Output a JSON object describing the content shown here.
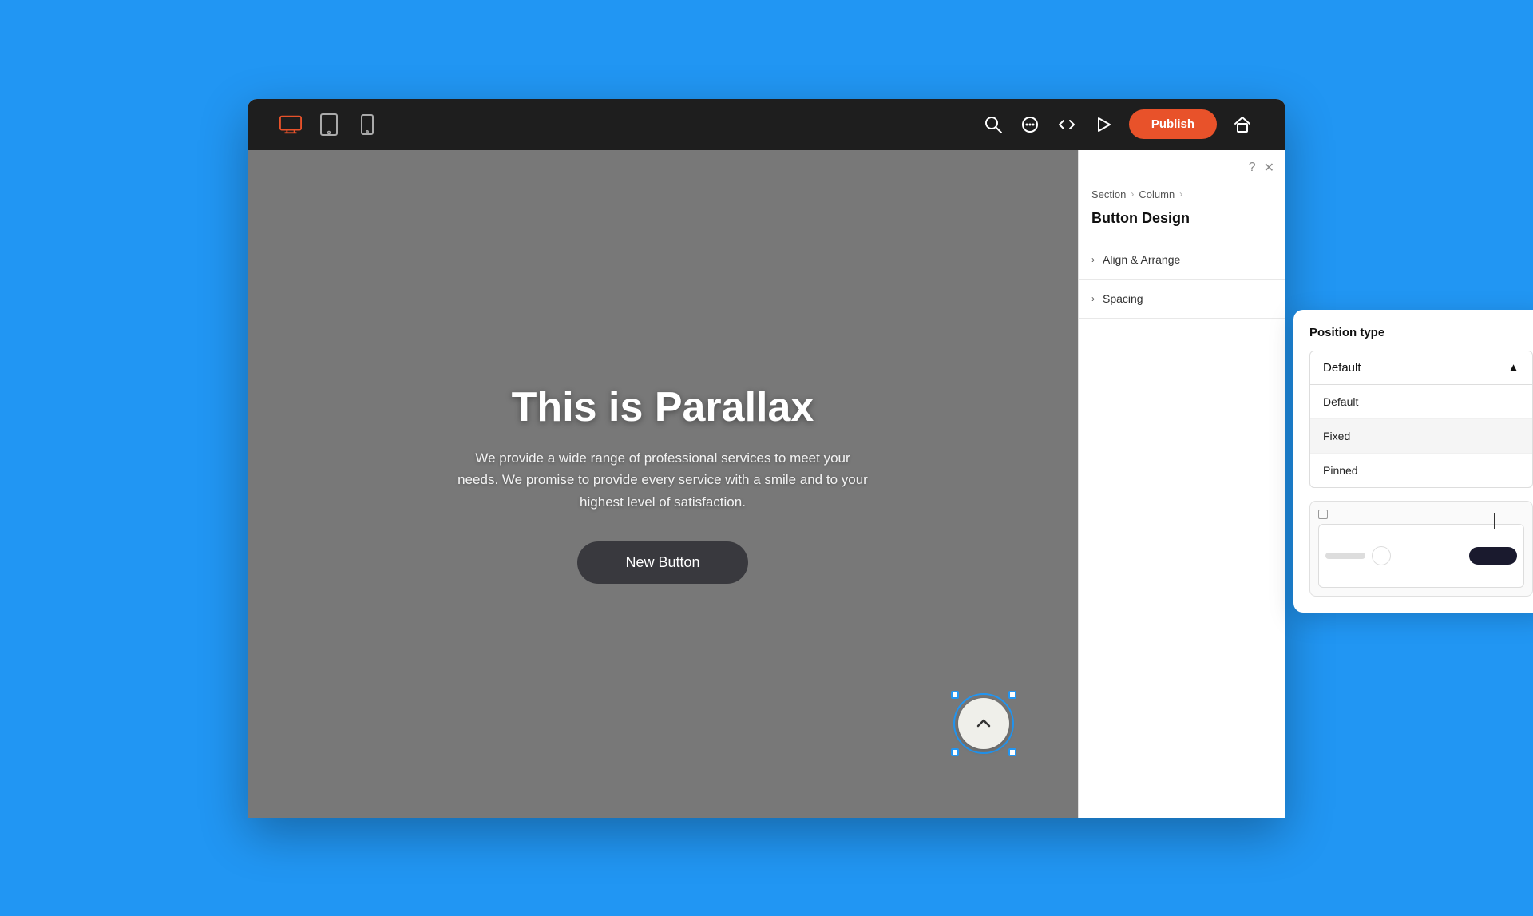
{
  "topbar": {
    "device_icons": [
      {
        "name": "desktop",
        "active": true
      },
      {
        "name": "tablet",
        "active": false
      },
      {
        "name": "mobile",
        "active": false
      }
    ],
    "publish_label": "Publish",
    "tools": [
      "search",
      "chat",
      "code",
      "play",
      "home"
    ]
  },
  "canvas": {
    "title": "This is Parallax",
    "subtitle": "We provide a wide range of professional services to meet your needs. We promise to provide every service with a smile and to your highest level of satisfaction.",
    "button_label": "New Button"
  },
  "panel": {
    "breadcrumb": [
      "Section",
      "Column"
    ],
    "title": "Button Design",
    "sections": [
      {
        "label": "Align & Arrange"
      },
      {
        "label": "Spacing"
      }
    ]
  },
  "floating": {
    "position_type_label": "Position type",
    "selected": "Default",
    "chevron_up": "▲",
    "options": [
      "Default",
      "Fixed",
      "Pinned"
    ]
  }
}
